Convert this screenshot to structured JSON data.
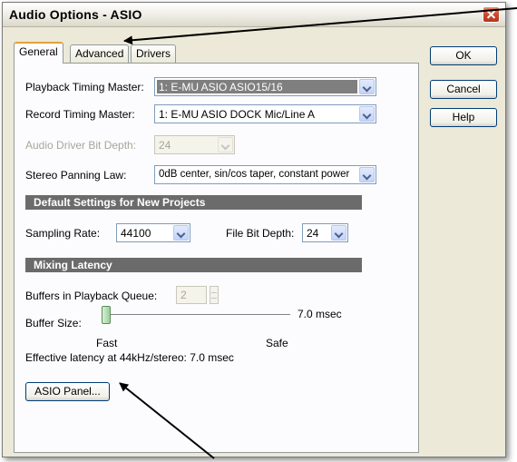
{
  "window": {
    "title": "Audio Options - ASIO"
  },
  "tabs": [
    {
      "label": "General",
      "active": true
    },
    {
      "label": "Advanced",
      "active": false
    },
    {
      "label": "Drivers",
      "active": false
    }
  ],
  "side_buttons": {
    "ok": "OK",
    "cancel": "Cancel",
    "help": "Help"
  },
  "general": {
    "playback_master": {
      "label": "Playback Timing Master:",
      "value": "1: E-MU ASIO ASIO15/16"
    },
    "record_master": {
      "label": "Record Timing Master:",
      "value": "1: E-MU ASIO DOCK Mic/Line A"
    },
    "bit_depth": {
      "label": "Audio Driver Bit Depth:",
      "value": "24"
    },
    "panning": {
      "label": "Stereo Panning Law:",
      "value": "0dB center, sin/cos taper, constant power"
    },
    "defaults_heading": "Default Settings for New Projects",
    "sampling_rate": {
      "label": "Sampling Rate:",
      "value": "44100"
    },
    "file_bit_depth": {
      "label": "File Bit Depth:",
      "value": "24"
    },
    "mixing_heading": "Mixing Latency",
    "buffers": {
      "label": "Buffers in Playback Queue:",
      "value": "2"
    },
    "buffer_size": {
      "label": "Buffer Size:",
      "value_text": "7.0 msec",
      "level": 0.0,
      "fast_label": "Fast",
      "safe_label": "Safe"
    },
    "effective_latency": "Effective latency at 44kHz/stereo:  7.0 msec",
    "asio_panel_button": "ASIO Panel..."
  }
}
